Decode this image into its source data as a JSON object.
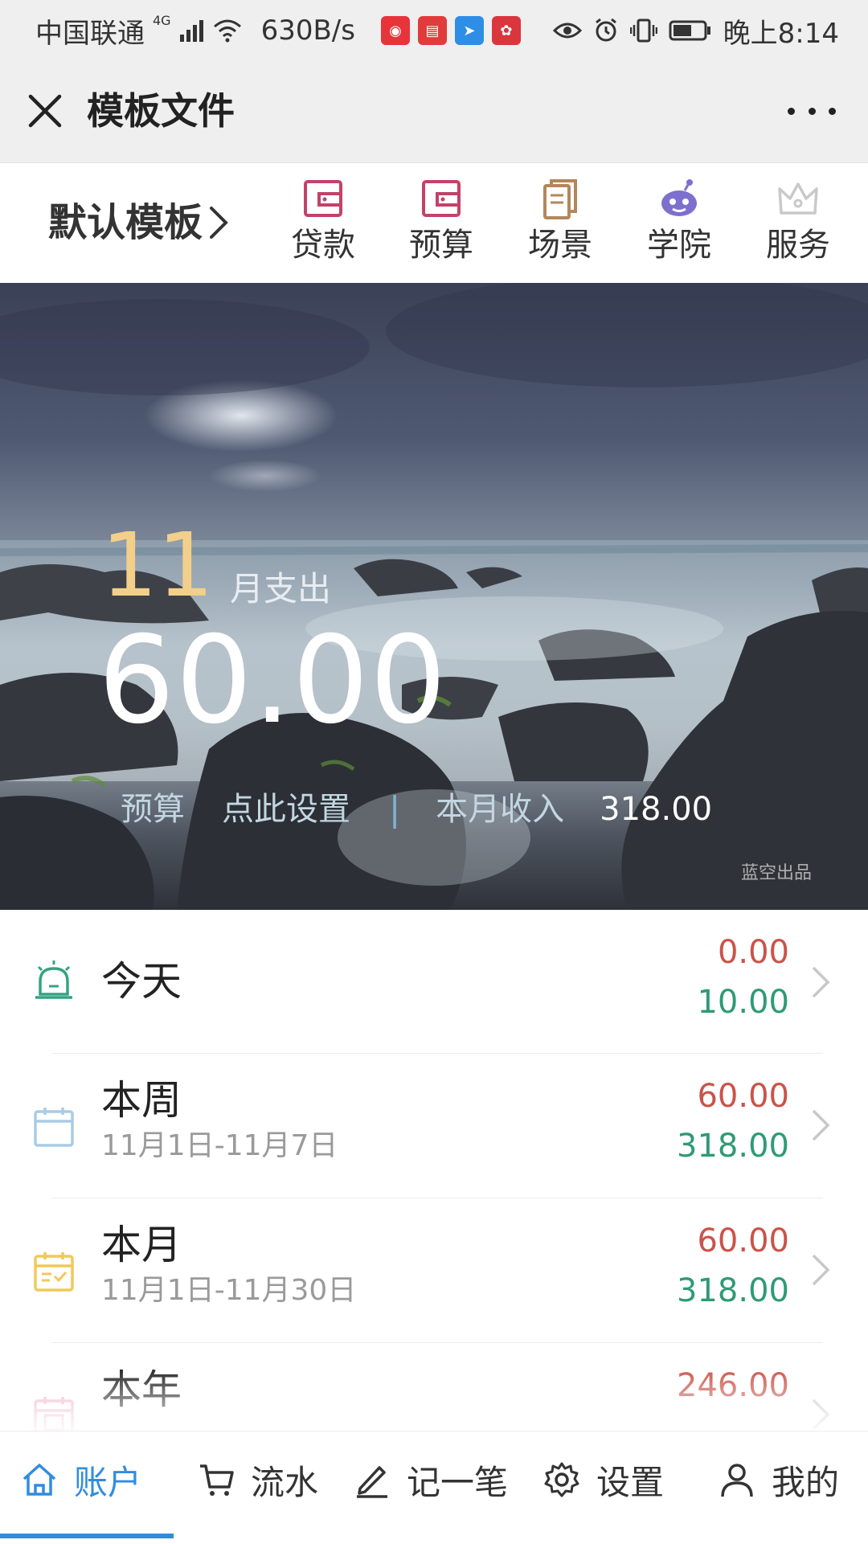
{
  "status_bar": {
    "carrier": "中国联通",
    "network": "4G",
    "speed": "630B/s",
    "time": "晚上8:14",
    "app_badges": [
      {
        "name": "netease-music-badge",
        "color": "#e8333a"
      },
      {
        "name": "reader-badge",
        "color": "#e23b3b"
      },
      {
        "name": "paper-plane-badge",
        "color": "#2e8ee6"
      },
      {
        "name": "huawei-badge",
        "color": "#d9363e"
      }
    ]
  },
  "title_bar": {
    "title": "模板文件"
  },
  "quick_nav": {
    "template_label": "默认模板",
    "items": [
      {
        "label": "贷款",
        "icon": "wallet-icon",
        "color": "#c3426a"
      },
      {
        "label": "预算",
        "icon": "wallet-icon",
        "color": "#c3426a"
      },
      {
        "label": "场景",
        "icon": "clipboard-icon",
        "color": "#b4875a"
      },
      {
        "label": "学院",
        "icon": "robot-icon",
        "color": "#7d6fce"
      },
      {
        "label": "服务",
        "icon": "crown-icon",
        "color": "#c9c9c9"
      }
    ]
  },
  "hero": {
    "month": "11",
    "month_label": "月支出",
    "total_expense": "60.00",
    "budget_label": "预算",
    "budget_action": "点此设置",
    "separator": "|",
    "income_label": "本月收入",
    "income_value": "318.00",
    "watermark": "蓝空出品"
  },
  "summary": [
    {
      "title": "今天",
      "subtitle": "",
      "expense": "0.00",
      "income": "10.00",
      "icon": "alarm-icon",
      "icon_color": "#34a382"
    },
    {
      "title": "本周",
      "subtitle": "11月1日-11月7日",
      "expense": "60.00",
      "income": "318.00",
      "icon": "calendar-icon",
      "icon_color": "#a9cbe6"
    },
    {
      "title": "本月",
      "subtitle": "11月1日-11月30日",
      "expense": "60.00",
      "income": "318.00",
      "icon": "calendar-check-icon",
      "icon_color": "#f0c95a"
    },
    {
      "title": "本年",
      "subtitle": "",
      "expense": "246.00",
      "income": "",
      "icon": "calendar-year-icon",
      "icon_color": "#f1b4c4"
    }
  ],
  "tabs": [
    {
      "label": "账户",
      "icon": "home-icon",
      "active": true
    },
    {
      "label": "流水",
      "icon": "cart-icon",
      "active": false
    },
    {
      "label": "记一笔",
      "icon": "pencil-icon",
      "active": false
    },
    {
      "label": "设置",
      "icon": "gear-icon",
      "active": false
    },
    {
      "label": "我的",
      "icon": "user-icon",
      "active": false
    }
  ],
  "colors": {
    "expense": "#c9544a",
    "income": "#2f9a77",
    "accent": "#2f8de0",
    "month_highlight": "#f2d08a"
  }
}
